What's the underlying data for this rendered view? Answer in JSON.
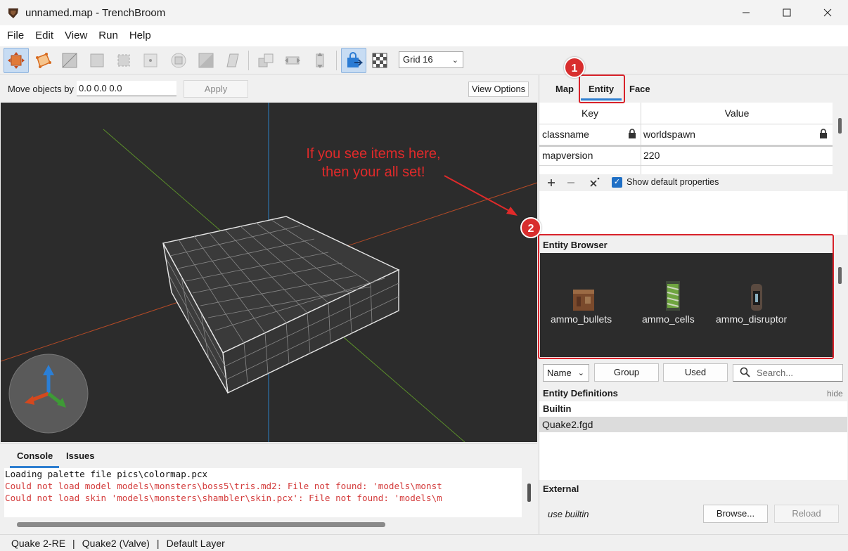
{
  "window": {
    "title": "unnamed.map - TrenchBroom"
  },
  "menu": [
    "File",
    "Edit",
    "View",
    "Run",
    "Help"
  ],
  "toolbar": {
    "grid_value": "Grid 16"
  },
  "move_bar": {
    "label": "Move objects by",
    "input_value": "0.0 0.0 0.0",
    "apply_label": "Apply",
    "view_options_label": "View Options"
  },
  "annotation": {
    "line1": "If you see items here,",
    "line2": "then your all set!",
    "badge1": "1",
    "badge2": "2",
    "color": "#d8222a"
  },
  "console": {
    "tabs": [
      "Console",
      "Issues"
    ],
    "lines": [
      {
        "text": "Loading palette file pics\\colormap.pcx",
        "kind": "info"
      },
      {
        "text": "Could not load model models\\monsters\\boss5\\tris.md2: File not found: 'models\\monst",
        "kind": "error"
      },
      {
        "text": "Could not load skin 'models\\monsters\\shambler\\skin.pcx': File not found: 'models\\m",
        "kind": "error"
      }
    ]
  },
  "statusbar": {
    "game": "Quake 2-RE",
    "format": "Quake2 (Valve)",
    "layer": "Default Layer",
    "separator": "|"
  },
  "inspector": {
    "tabs": [
      "Map",
      "Entity",
      "Face"
    ],
    "active_tab": "Entity",
    "table": {
      "headers": [
        "Key",
        "Value"
      ],
      "rows": [
        {
          "key": "classname",
          "value": "worldspawn"
        },
        {
          "key": "mapversion",
          "value": "220"
        }
      ]
    },
    "show_default_label": "Show default properties",
    "show_default_checked": true,
    "entity_browser": {
      "title": "Entity Browser",
      "items": [
        "ammo_bullets",
        "ammo_cells",
        "ammo_disruptor"
      ]
    },
    "filter": {
      "sort_value": "Name",
      "group_label": "Group",
      "used_label": "Used",
      "search_placeholder": "Search..."
    },
    "entity_definitions": {
      "title": "Entity Definitions",
      "hide_label": "hide",
      "builtin_heading": "Builtin",
      "builtin_selected": "Quake2.fgd",
      "external_heading": "External",
      "external_value": "use builtin",
      "browse_label": "Browse...",
      "reload_label": "Reload"
    }
  },
  "colors": {
    "accent": "#2f7fd0",
    "viewport_bg": "#2c2c2c",
    "error_text": "#d33a3a"
  }
}
